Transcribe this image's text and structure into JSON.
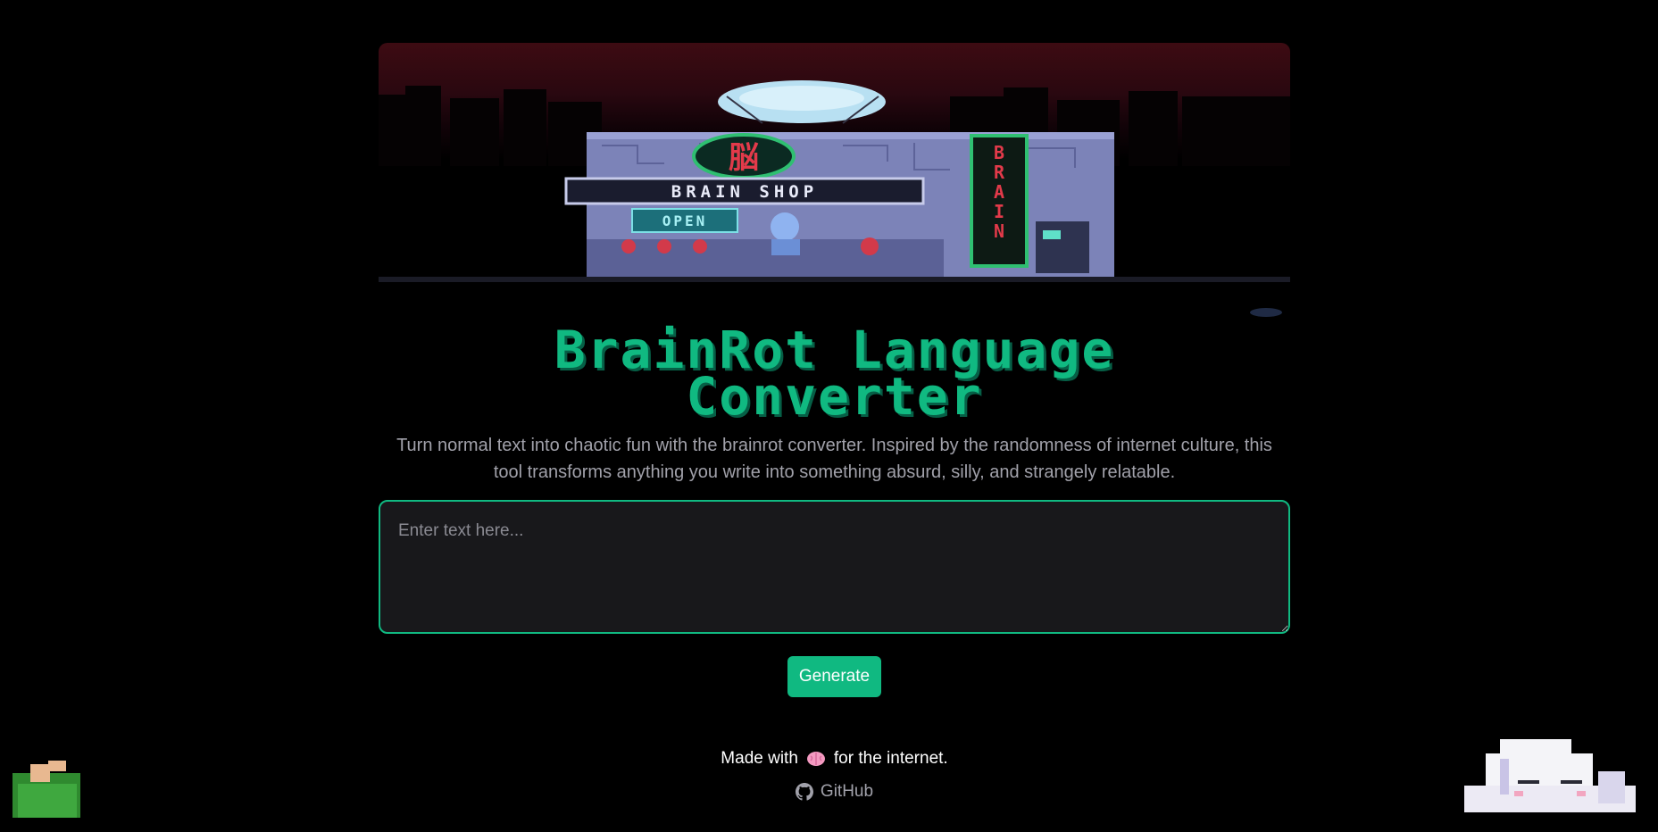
{
  "banner": {
    "shop_sign": "BRAIN SHOP",
    "side_sign": "BRAIN",
    "open_sign": "OPEN"
  },
  "header": {
    "title_line1": "BrainRot Language",
    "title_line2": "Converter",
    "description": "Turn normal text into chaotic fun with the brainrot converter. Inspired by the randomness of internet culture, this tool transforms anything you write into something absurd, silly, and strangely relatable."
  },
  "input": {
    "placeholder": "Enter text here...",
    "value": ""
  },
  "actions": {
    "generate_label": "Generate"
  },
  "footer": {
    "made_prefix": "Made with",
    "made_suffix": "for the internet.",
    "github_label": "GitHub"
  },
  "colors": {
    "accent": "#10b981",
    "background": "#000000",
    "input_bg": "#18181b"
  }
}
